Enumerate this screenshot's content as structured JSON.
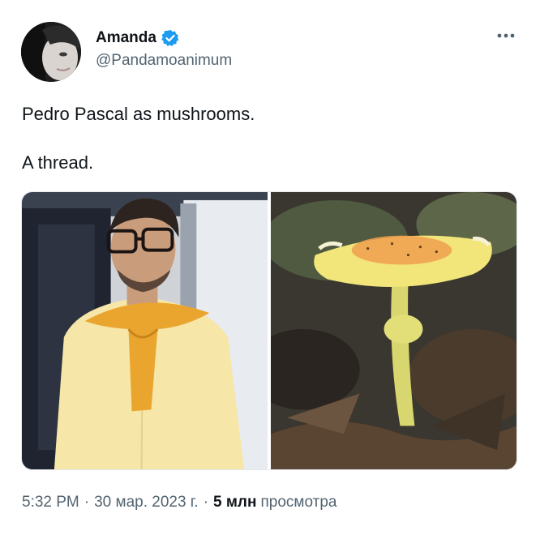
{
  "author": {
    "display_name": "Amanda",
    "handle": "@Pandamoanimum",
    "avatar_icon": "profile-avatar",
    "verified_icon": "verified-badge-icon",
    "verified_color": "#1d9bf0"
  },
  "more_icon": "more-horizontal-icon",
  "tweet": {
    "line1": "Pedro Pascal as mushrooms.",
    "line2": "A thread."
  },
  "media": {
    "left_photo": "man-in-yellow-outfit-photo",
    "right_photo": "yellow-mushroom-photo"
  },
  "meta": {
    "time": "5:32 PM",
    "date": "30 мар. 2023 г.",
    "separator": "·",
    "views_count": "5 млн",
    "views_label": "просмотра"
  },
  "colors": {
    "text_primary": "#0f1419",
    "text_secondary": "#536471",
    "accent": "#1d9bf0"
  }
}
